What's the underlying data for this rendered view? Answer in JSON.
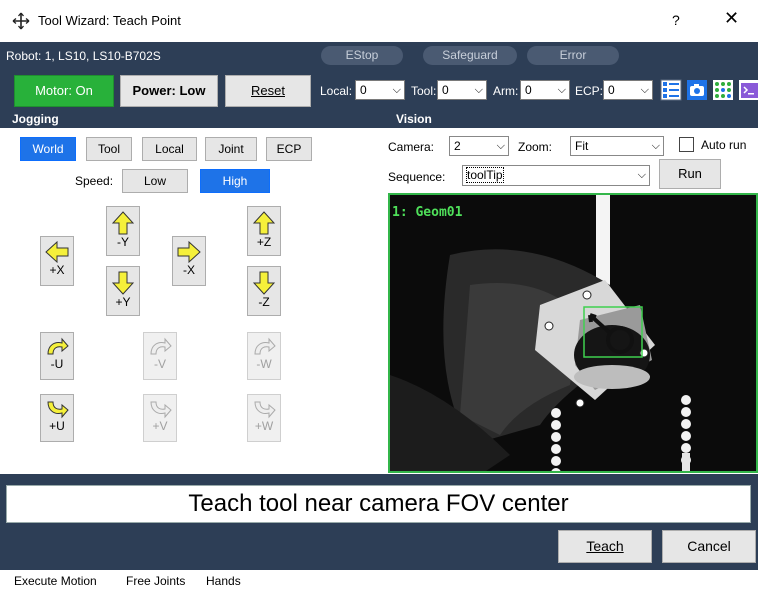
{
  "window": {
    "title": "Tool Wizard: Teach Point",
    "help": "?",
    "close": "✕"
  },
  "robot": {
    "label": "Robot: 1, LS10, LS10-B702S",
    "indicators": [
      "EStop",
      "Safeguard",
      "Error"
    ]
  },
  "controls": {
    "motor": "Motor: On",
    "power": "Power: Low",
    "reset": "Reset",
    "local_label": "Local:",
    "local_value": "0",
    "tool_label": "Tool:",
    "tool_value": "0",
    "arm_label": "Arm:",
    "arm_value": "0",
    "ecp_label": "ECP:",
    "ecp_value": "0"
  },
  "jogging": {
    "header": "Jogging",
    "modes": [
      "World",
      "Tool",
      "Local",
      "Joint",
      "ECP"
    ],
    "active_mode": "World",
    "speed_label": "Speed:",
    "speeds": [
      "Low",
      "High"
    ],
    "active_speed": "High",
    "buttons": {
      "plus_x": "+X",
      "minus_y": "-Y",
      "minus_x": "-X",
      "plus_y": "+Y",
      "plus_z": "+Z",
      "minus_z": "-Z",
      "minus_u": "-U",
      "minus_v": "-V",
      "minus_w": "-W",
      "plus_u": "+U",
      "plus_v": "+V",
      "plus_w": "+W"
    }
  },
  "vision": {
    "header": "Vision",
    "camera_label": "Camera:",
    "camera_value": "2",
    "zoom_label": "Zoom:",
    "zoom_value": "Fit",
    "autorun_label": "Auto run",
    "sequence_label": "Sequence:",
    "sequence_value": "toolTip",
    "run": "Run",
    "overlay_label": "1: Geom01"
  },
  "message": "Teach tool near camera FOV center",
  "actions": {
    "teach": "Teach",
    "cancel": "Cancel"
  },
  "statusbar": [
    "Execute Motion",
    "Free Joints",
    "Hands"
  ],
  "colors": {
    "panel": "#2d3e56",
    "motor_on": "#28b13a",
    "active": "#1e73e8",
    "arrow": "#f5f03a",
    "vision_ok": "#33b64a"
  }
}
